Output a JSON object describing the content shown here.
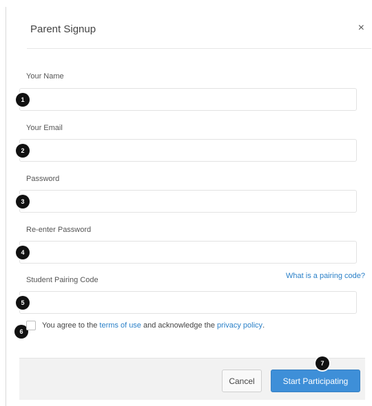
{
  "dialog": {
    "title": "Parent Signup",
    "close_glyph": "×"
  },
  "form": {
    "name_label": "Your Name",
    "email_label": "Your Email",
    "password_label": "Password",
    "reenter_label": "Re-enter Password",
    "pairing_label": "Student Pairing Code",
    "pairing_link": "What is a pairing code?",
    "name_value": "",
    "email_value": "",
    "password_value": "",
    "reenter_value": "",
    "pairing_value": ""
  },
  "agreement": {
    "prefix": "You agree to the",
    "terms_link": "terms of use",
    "middle": "and acknowledge the",
    "privacy_link": "privacy policy",
    "suffix": "."
  },
  "footer": {
    "cancel_label": "Cancel",
    "start_label": "Start Participating"
  },
  "markers": [
    "1",
    "2",
    "3",
    "4",
    "5",
    "6",
    "7"
  ],
  "colors": {
    "accent": "#3e8fd8",
    "link": "#2a80c8",
    "marker": "#111111"
  }
}
